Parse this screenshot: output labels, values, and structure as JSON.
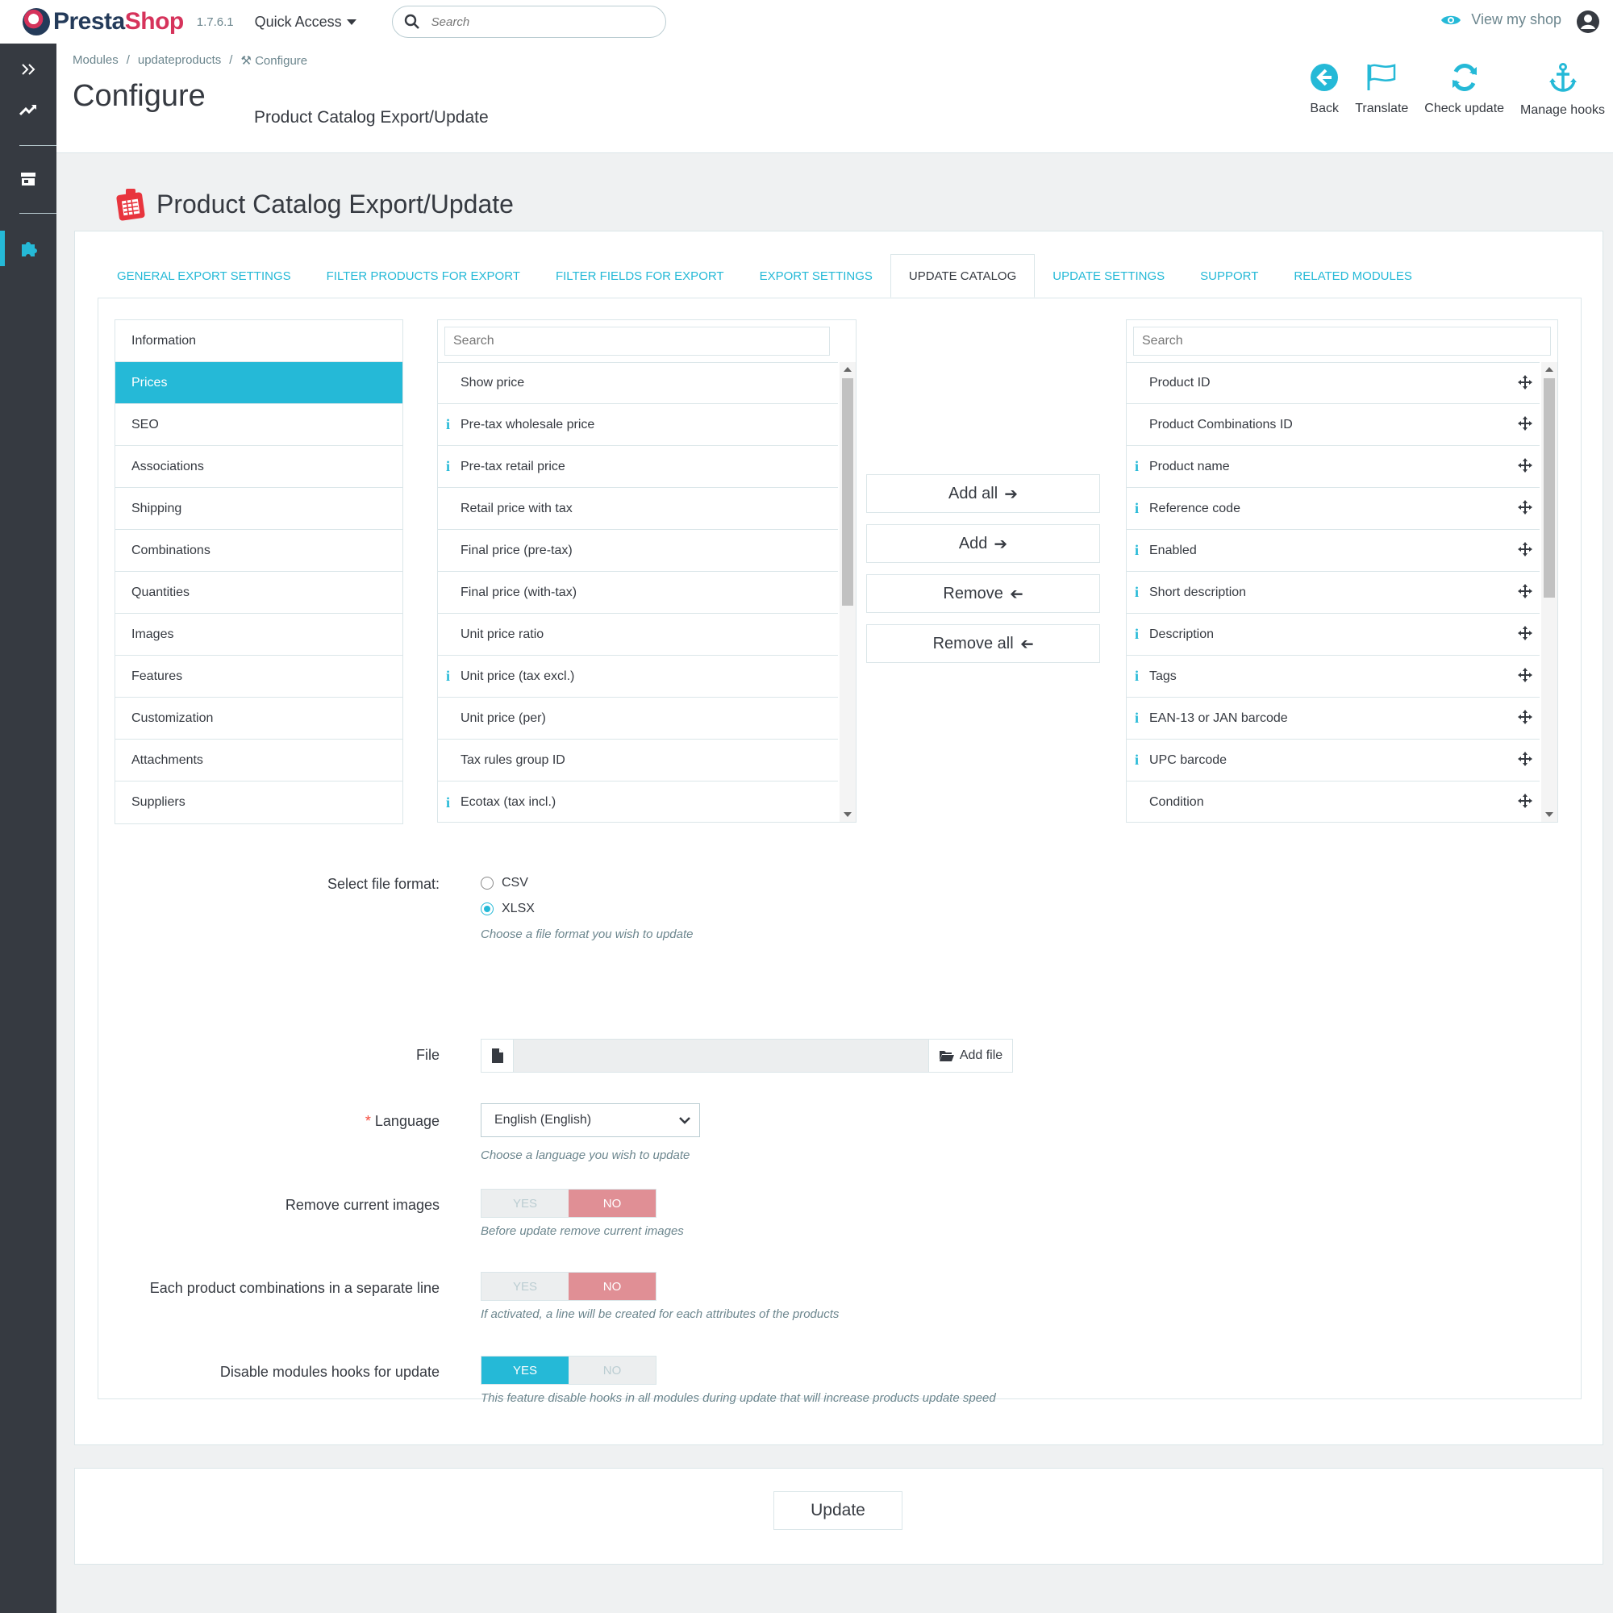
{
  "header": {
    "logo_main": "Presta",
    "logo_accent": "Shop",
    "version": "1.7.6.1",
    "quick_access": "Quick Access",
    "search_placeholder": "Search",
    "view_shop": "View my shop"
  },
  "breadcrumb": [
    "Modules",
    "/",
    "updateproducts",
    "/",
    "Configure"
  ],
  "page": {
    "title": "Configure",
    "subtitle": "Product Catalog Export/Update"
  },
  "toolbar": {
    "back": "Back",
    "translate": "Translate",
    "check_update": "Check update",
    "manage_hooks": "Manage hooks"
  },
  "module": {
    "title": "Product Catalog Export/Update"
  },
  "tabs": [
    {
      "label": "General export settings",
      "active": false
    },
    {
      "label": "Filter products for export",
      "active": false
    },
    {
      "label": "Filter fields for export",
      "active": false
    },
    {
      "label": "Export settings",
      "active": false
    },
    {
      "label": "Update catalog",
      "active": true
    },
    {
      "label": "Update settings",
      "active": false
    },
    {
      "label": "Support",
      "active": false
    },
    {
      "label": "Related modules",
      "active": false
    }
  ],
  "categories": [
    {
      "label": "Information",
      "active": false
    },
    {
      "label": "Prices",
      "active": true
    },
    {
      "label": "SEO",
      "active": false
    },
    {
      "label": "Associations",
      "active": false
    },
    {
      "label": "Shipping",
      "active": false
    },
    {
      "label": "Combinations",
      "active": false
    },
    {
      "label": "Quantities",
      "active": false
    },
    {
      "label": "Images",
      "active": false
    },
    {
      "label": "Features",
      "active": false
    },
    {
      "label": "Customization",
      "active": false
    },
    {
      "label": "Attachments",
      "active": false
    },
    {
      "label": "Suppliers",
      "active": false
    }
  ],
  "available_fields": {
    "search_placeholder": "Search",
    "items": [
      {
        "label": "Show price",
        "info": false
      },
      {
        "label": "Pre-tax wholesale price",
        "info": true
      },
      {
        "label": "Pre-tax retail price",
        "info": true
      },
      {
        "label": "Retail price with tax",
        "info": false
      },
      {
        "label": "Final price (pre-tax)",
        "info": false
      },
      {
        "label": "Final price (with-tax)",
        "info": false
      },
      {
        "label": "Unit price ratio",
        "info": false
      },
      {
        "label": "Unit price (tax excl.)",
        "info": true
      },
      {
        "label": "Unit price (per)",
        "info": false
      },
      {
        "label": "Tax rules group ID",
        "info": false
      },
      {
        "label": "Ecotax (tax incl.)",
        "info": true
      }
    ]
  },
  "selected_fields": {
    "search_placeholder": "Search",
    "items": [
      {
        "label": "Product ID",
        "info": false
      },
      {
        "label": "Product Combinations ID",
        "info": false
      },
      {
        "label": "Product name",
        "info": true
      },
      {
        "label": "Reference code",
        "info": true
      },
      {
        "label": "Enabled",
        "info": true
      },
      {
        "label": "Short description",
        "info": true
      },
      {
        "label": "Description",
        "info": true
      },
      {
        "label": "Tags",
        "info": true
      },
      {
        "label": "EAN-13 or JAN barcode",
        "info": true
      },
      {
        "label": "UPC barcode",
        "info": true
      },
      {
        "label": "Condition",
        "info": false
      }
    ]
  },
  "move_buttons": {
    "add_all": "Add all",
    "add": "Add",
    "remove": "Remove",
    "remove_all": "Remove all"
  },
  "form": {
    "file_format_label": "Select file format:",
    "format_csv": "CSV",
    "format_xlsx": "XLSX",
    "format_selected": "XLSX",
    "format_hint": "Choose a file format you wish to update",
    "file_label": "File",
    "add_file": "Add file",
    "language_label": "Language",
    "language_required": "*",
    "language_value": "English (English)",
    "language_hint": "Choose a language you wish to update",
    "remove_images_label": "Remove current images",
    "remove_images_value": "NO",
    "remove_images_hint": "Before update remove current images",
    "combinations_label": "Each product combinations in a separate line",
    "combinations_value": "NO",
    "combinations_hint": "If activated, a line will be created for each attributes of the products",
    "disable_hooks_label": "Disable modules hooks for update",
    "disable_hooks_value": "YES",
    "disable_hooks_hint": "This feature disable hooks in all modules during update that will increase products update speed",
    "yes": "YES",
    "no": "NO"
  },
  "footer": {
    "update": "Update"
  },
  "colors": {
    "accent": "#25b9d7",
    "sidebar": "#363a41",
    "switch_no": "#e08f95",
    "logo_red": "#d6335b"
  }
}
